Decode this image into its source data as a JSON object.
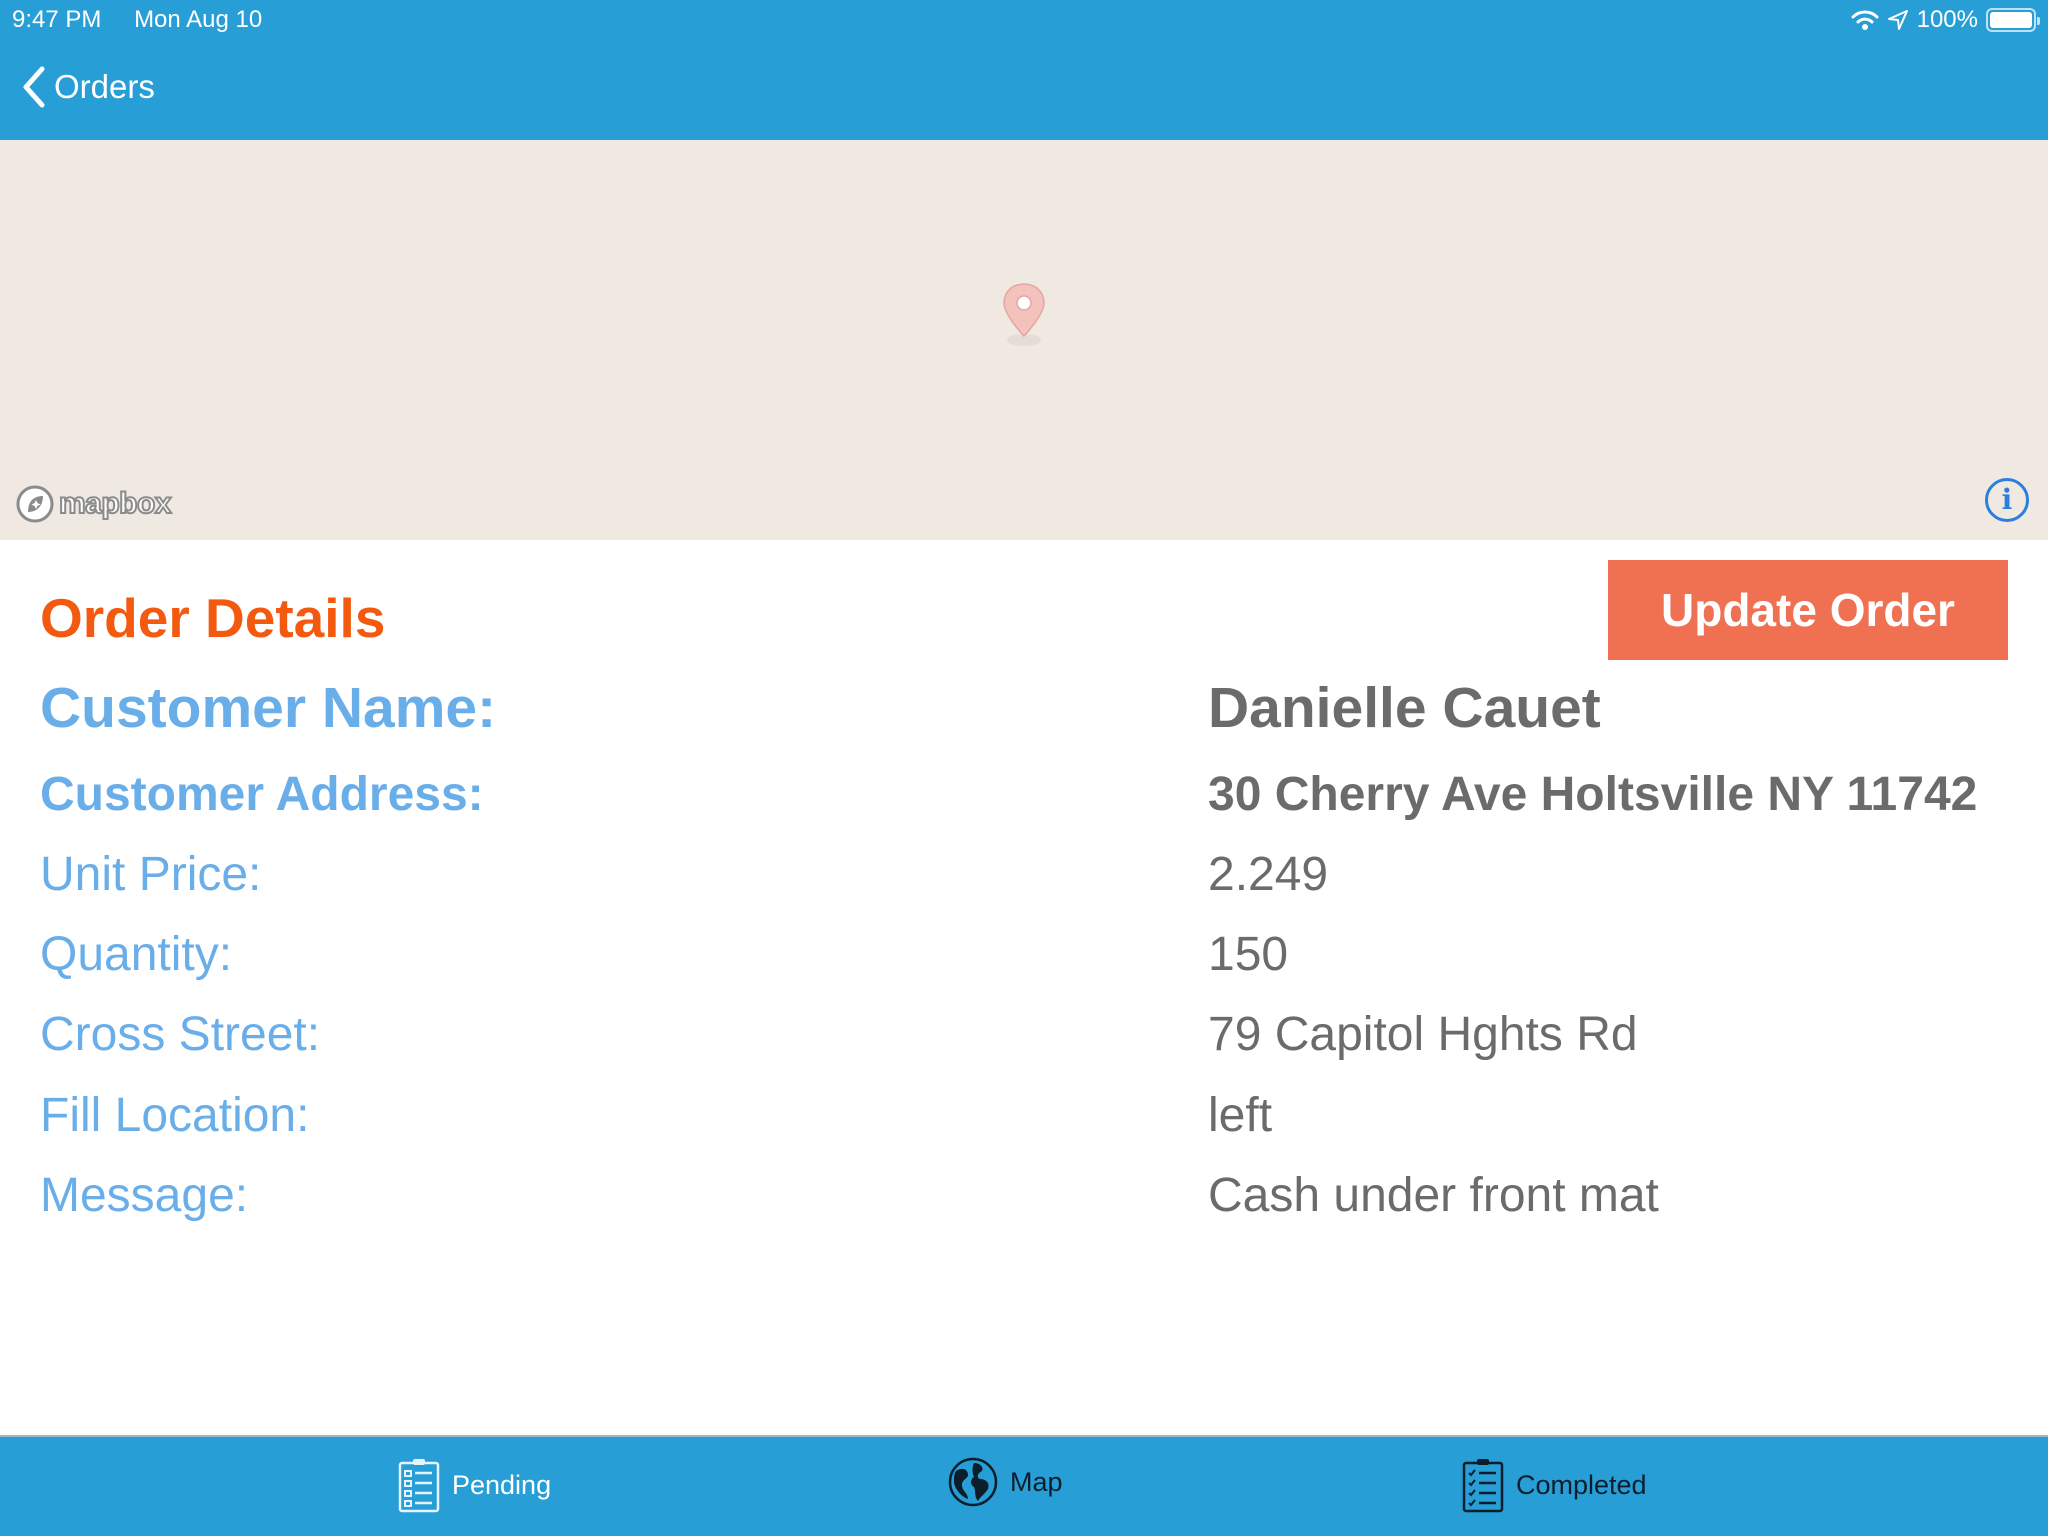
{
  "status_bar": {
    "time": "9:47 PM",
    "date": "Mon Aug 10",
    "battery": "100%",
    "icons": [
      "wifi-icon",
      "location-arrow-icon",
      "battery-icon"
    ]
  },
  "nav": {
    "back_label": "Orders"
  },
  "map": {
    "attribution_logo": "mapbox",
    "info_glyph": "i"
  },
  "details": {
    "title": "Order Details",
    "update_button": "Update Order",
    "rows": [
      {
        "label": "Customer Name:",
        "value": "Danielle Cauet"
      },
      {
        "label": "Customer Address:",
        "value": "30 Cherry Ave Holtsville NY 11742"
      },
      {
        "label": "Unit Price:",
        "value": "2.249"
      },
      {
        "label": "Quantity:",
        "value": "150"
      },
      {
        "label": "Cross Street:",
        "value": "79 Capitol Hghts Rd"
      },
      {
        "label": "Fill Location:",
        "value": "left"
      },
      {
        "label": "Message:",
        "value": "Cash under front mat"
      }
    ]
  },
  "tabs": [
    {
      "label": "Pending",
      "icon": "clipboard-list-icon"
    },
    {
      "label": "Map",
      "icon": "globe-icon"
    },
    {
      "label": "Completed",
      "icon": "clipboard-check-icon"
    }
  ],
  "colors": {
    "brand_blue": "#279fd6",
    "title_orange": "#f35a0f",
    "button_orange": "#f07152",
    "label_blue": "#6aaee9",
    "value_gray": "#6b6b6b",
    "map_bg": "#efe9e2"
  }
}
